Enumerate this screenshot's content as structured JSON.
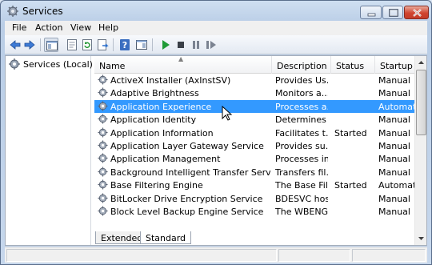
{
  "window": {
    "title": "Services"
  },
  "menu": {
    "items": [
      "File",
      "Action",
      "View",
      "Help"
    ]
  },
  "toolbar": {
    "icons": [
      "back-arrow-icon",
      "forward-arrow-icon",
      "console-tree-icon",
      "properties-icon",
      "refresh-icon",
      "export-list-icon",
      "help-icon",
      "show-pane-icon",
      "start-service-icon",
      "stop-service-icon",
      "pause-service-icon",
      "restart-service-icon"
    ]
  },
  "tree": {
    "root_label": "Services (Local)"
  },
  "columns": {
    "name": "Name",
    "description": "Description",
    "status": "Status",
    "startup": "Startup Typ"
  },
  "services": [
    {
      "name": "ActiveX Installer (AxInstSV)",
      "description": "Provides Us...",
      "status": "",
      "startup": "Manual"
    },
    {
      "name": "Adaptive Brightness",
      "description": "Monitors a...",
      "status": "",
      "startup": "Manual"
    },
    {
      "name": "Application Experience",
      "description": "Processes a...",
      "status": "",
      "startup": "Automatic",
      "selected": true
    },
    {
      "name": "Application Identity",
      "description": "Determines ...",
      "status": "",
      "startup": "Manual"
    },
    {
      "name": "Application Information",
      "description": "Facilitates t...",
      "status": "Started",
      "startup": "Manual"
    },
    {
      "name": "Application Layer Gateway Service",
      "description": "Provides su...",
      "status": "",
      "startup": "Manual"
    },
    {
      "name": "Application Management",
      "description": "Processes in...",
      "status": "",
      "startup": "Manual"
    },
    {
      "name": "Background Intelligent Transfer Service",
      "description": "Transfers fil...",
      "status": "",
      "startup": "Manual"
    },
    {
      "name": "Base Filtering Engine",
      "description": "The Base Fil...",
      "status": "Started",
      "startup": "Automatic"
    },
    {
      "name": "BitLocker Drive Encryption Service",
      "description": "BDESVC hos...",
      "status": "",
      "startup": "Manual"
    },
    {
      "name": "Block Level Backup Engine Service",
      "description": "The WBENG...",
      "status": "",
      "startup": "Manual"
    }
  ],
  "tabs": {
    "extended": "Extended",
    "standard": "Standard",
    "active": "Standard"
  },
  "colors": {
    "selection": "#3399ff",
    "close_button": "#d0452f",
    "play_icon": "#1f9a36"
  }
}
